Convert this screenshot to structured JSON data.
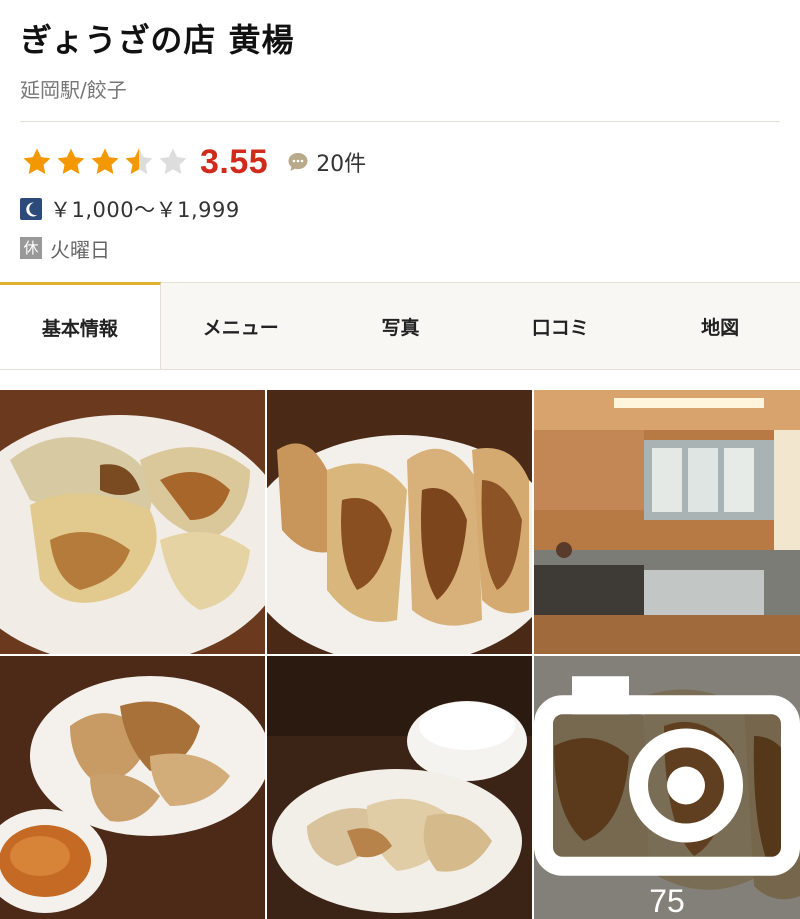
{
  "restaurant": {
    "name": "ぎょうざの店 黄楊",
    "location_genre": "延岡駅/餃子"
  },
  "rating": {
    "stars": 3.5,
    "score": "3.55",
    "review_count": "20件",
    "star_color": "#f39800",
    "score_color": "#cf2a1c"
  },
  "price": {
    "icon": "moon-icon",
    "range": "￥1,000～￥1,999"
  },
  "holiday": {
    "badge": "休",
    "days": "火曜日"
  },
  "tabs": [
    {
      "label": "基本情報",
      "active": true
    },
    {
      "label": "メニュー",
      "active": false
    },
    {
      "label": "写真",
      "active": false
    },
    {
      "label": "口コミ",
      "active": false
    },
    {
      "label": "地図",
      "active": false
    }
  ],
  "photos": {
    "more_count": "75",
    "more_icon": "camera-icon"
  },
  "colors": {
    "accent": "#e0b32f",
    "tab_bg": "#f8f7f4"
  }
}
